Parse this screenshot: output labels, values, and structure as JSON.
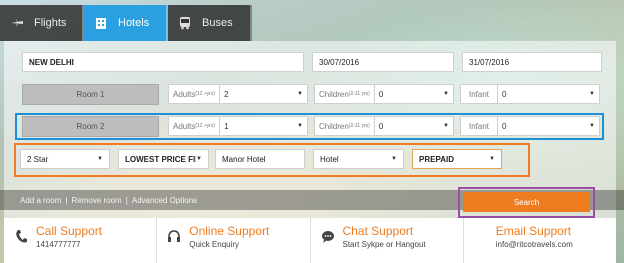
{
  "tabs": [
    {
      "label": "Flights",
      "icon": "plane-icon",
      "active": false
    },
    {
      "label": "Hotels",
      "icon": "building-icon",
      "active": true
    },
    {
      "label": "Buses",
      "icon": "bus-icon",
      "active": false
    }
  ],
  "search": {
    "city": "NEW DELHI",
    "checkin": "30/07/2016",
    "checkout": "31/07/2016"
  },
  "rooms": [
    {
      "label": "Room 1",
      "adults_label": "Adults",
      "adults_age": "(12 +yrs)",
      "adults_value": "2",
      "children_label": "Children",
      "children_age": "(2-11 yrs)",
      "children_value": "0",
      "infant_label": "Infant",
      "infant_value": "0"
    },
    {
      "label": "Room 2",
      "adults_label": "Adults",
      "adults_age": "(12 +yrs)",
      "adults_value": "1",
      "children_label": "Children",
      "children_age": "(2-11 yrs)",
      "children_value": "0",
      "infant_label": "Infant",
      "infant_value": "0"
    }
  ],
  "filters": {
    "star": "2 Star",
    "sort": "LOWEST PRICE FIRS",
    "hotel_name": "Manor Hotel",
    "type": "Hotel",
    "payment": "PREPAID"
  },
  "links": {
    "add_room": "Add a room",
    "sep": "|",
    "remove_room": "Remove room",
    "advanced": "Advanced Options"
  },
  "search_button": "Search",
  "support": [
    {
      "title": "Call Support",
      "detail": "1414777777",
      "icon": "phone-icon"
    },
    {
      "title": "Online Support",
      "detail": "Quick Enquiry",
      "icon": "headset-icon"
    },
    {
      "title": "Chat Support",
      "detail": "Start Sykpe or Hangout",
      "icon": "chat-icon"
    },
    {
      "title": "Email Support",
      "detail": "info@ritcotravels.com",
      "icon": "envelope-icon"
    }
  ],
  "colors": {
    "tab_active": "#2aa0e0",
    "accent": "#ef7c1f",
    "highlight_blue": "#1e90d8",
    "highlight_orange": "#f07b20",
    "highlight_purple": "#9b4ca5"
  }
}
